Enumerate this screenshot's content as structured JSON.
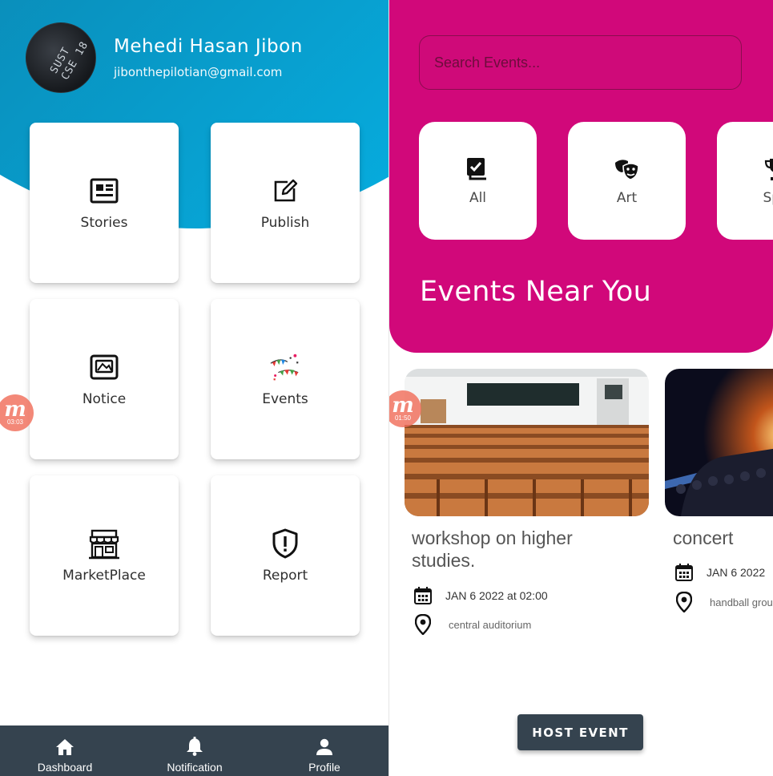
{
  "dashboard": {
    "user": {
      "name": "Mehedi Hasan Jibon",
      "email": "jibonthepilotian@gmail.com",
      "avatar_text": "SUST CSE 18"
    },
    "cards": [
      {
        "label": "Stories",
        "icon": "newspaper-icon"
      },
      {
        "label": "Publish",
        "icon": "edit-note-icon"
      },
      {
        "label": "Notice",
        "icon": "notice-board-icon"
      },
      {
        "label": "Events",
        "icon": "party-bunting-icon"
      },
      {
        "label": "MarketPlace",
        "icon": "storefront-icon"
      },
      {
        "label": "Report",
        "icon": "shield-alert-icon"
      }
    ],
    "recorder_badge": {
      "letter": "m",
      "time": "03:03"
    },
    "bottom_nav": [
      {
        "label": "Dashboard",
        "icon": "home-icon"
      },
      {
        "label": "Notification",
        "icon": "bell-icon"
      },
      {
        "label": "Profile",
        "icon": "person-icon"
      }
    ],
    "colors": {
      "header_gradient_start": "#0b5f7f",
      "header_gradient_end": "#05b6ea",
      "nav_bg": "#35434f"
    }
  },
  "events_screen": {
    "search": {
      "placeholder": "Search Events..."
    },
    "categories": [
      {
        "label": "All",
        "icon": "checkbox-multiple-icon"
      },
      {
        "label": "Art",
        "icon": "theater-masks-icon"
      },
      {
        "label": "Spo",
        "icon": "trophy-icon"
      }
    ],
    "section_title": "Events Near You",
    "events": [
      {
        "title": "workshop on higher studies.",
        "date": "JAN 6 2022 at 02:00",
        "location": "central auditorium",
        "image": "auditorium-photo"
      },
      {
        "title": "concert",
        "date": "JAN 6 2022",
        "location": "handball grou",
        "image": "concert-photo"
      }
    ],
    "recorder_badge": {
      "letter": "m",
      "time": "01:50"
    },
    "host_button": "HOST EVENT",
    "colors": {
      "header_bg": "#d1087a",
      "button_bg": "#35434f"
    }
  }
}
